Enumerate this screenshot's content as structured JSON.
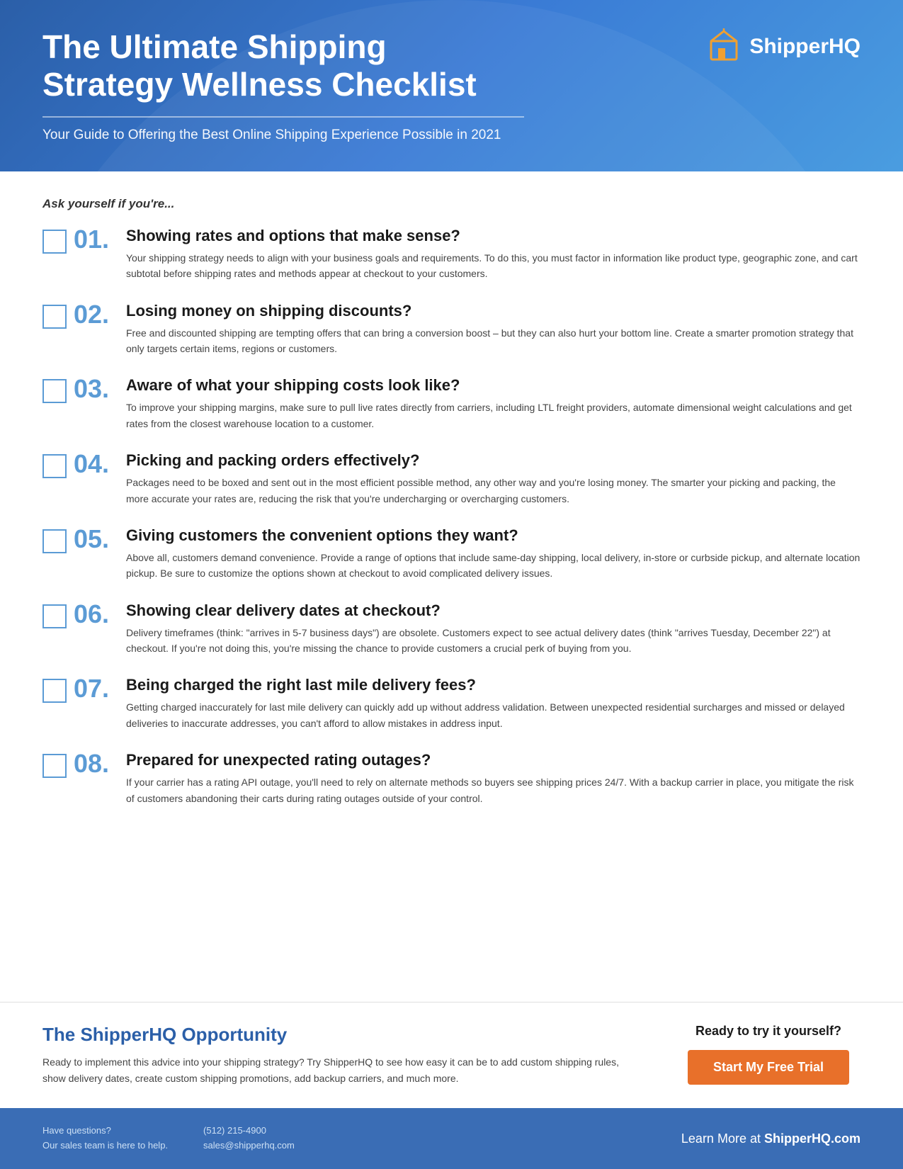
{
  "header": {
    "title": "The Ultimate Shipping Strategy Wellness Checklist",
    "subtitle": "Your Guide to Offering the Best Online Shipping Experience Possible in 2021",
    "logo_text": "ShipperHQ"
  },
  "intro": {
    "ask_label": "Ask yourself if you're..."
  },
  "checklist": [
    {
      "number": "01.",
      "heading": "Showing rates and options that make sense?",
      "desc": "Your shipping strategy needs to align with your business goals and requirements. To do this, you must factor in information like product type, geographic zone, and cart subtotal before shipping rates and methods appear at checkout to your customers."
    },
    {
      "number": "02.",
      "heading": "Losing money on shipping discounts?",
      "desc": "Free and discounted shipping are tempting offers that can bring a conversion boost – but they can also hurt your bottom line. Create a smarter promotion strategy that only targets certain items, regions or customers."
    },
    {
      "number": "03.",
      "heading": "Aware of what your shipping costs look like?",
      "desc": "To improve your shipping margins, make sure to pull live rates directly from carriers, including LTL freight providers, automate dimensional weight calculations and get rates from the closest warehouse location to a customer."
    },
    {
      "number": "04.",
      "heading": "Picking and packing orders effectively?",
      "desc": "Packages need to be boxed and sent out in the most efficient possible method, any other way and you're losing money. The smarter your picking and packing, the more accurate your rates are, reducing the risk that you're undercharging or overcharging customers."
    },
    {
      "number": "05.",
      "heading": "Giving customers the convenient options they want?",
      "desc": "Above all, customers demand convenience. Provide a range of options that include same-day shipping, local delivery, in-store or curbside pickup, and alternate location pickup. Be sure to customize the options shown at checkout to avoid complicated delivery issues."
    },
    {
      "number": "06.",
      "heading": "Showing clear delivery dates at checkout?",
      "desc": "Delivery timeframes (think: \"arrives in 5-7 business days\") are obsolete. Customers expect to see actual delivery dates (think \"arrives Tuesday, December 22\") at checkout. If you're not doing this, you're missing the chance to provide customers a crucial perk of buying from you."
    },
    {
      "number": "07.",
      "heading": "Being charged the right last mile delivery fees?",
      "desc": "Getting charged inaccurately for last mile delivery can quickly add up without address validation. Between unexpected residential surcharges and missed or delayed deliveries to inaccurate addresses, you can't afford to allow mistakes in address input."
    },
    {
      "number": "08.",
      "heading": "Prepared for unexpected rating outages?",
      "desc": "If your carrier has a rating API outage, you'll need to rely on alternate methods so buyers see shipping prices 24/7. With a backup carrier in place, you mitigate the risk of customers abandoning their carts during rating outages outside of your control."
    }
  ],
  "opportunity": {
    "title": "The ShipperHQ Opportunity",
    "desc": "Ready to implement this advice into your shipping strategy? Try ShipperHQ to see how easy it can be to add custom shipping rules, show delivery dates, create custom shipping promotions, add backup carriers, and much more.",
    "cta_label": "Ready to try it yourself?",
    "cta_button": "Start My Free Trial"
  },
  "footer": {
    "contact_line1": "Have questions?",
    "contact_line2": "Our sales team is here to help.",
    "phone": "(512) 215-4900",
    "email": "sales@shipperhq.com",
    "learn_text": "Learn More at ",
    "learn_brand": "ShipperHQ.com"
  }
}
